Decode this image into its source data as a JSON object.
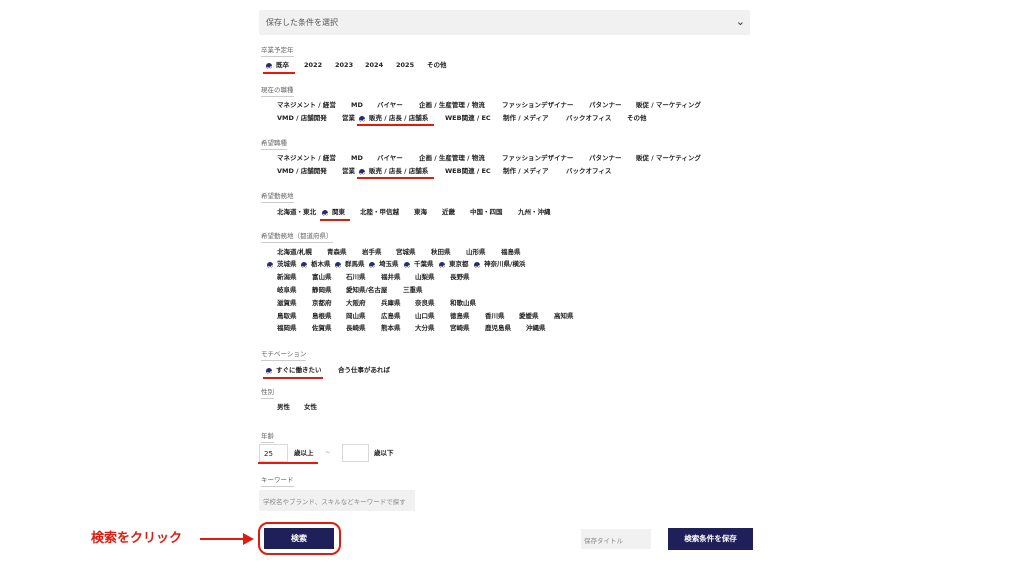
{
  "saved_select": {
    "value": "保存した条件を選択"
  },
  "graduation": {
    "label": "卒業予定年",
    "options": [
      "既卒",
      "2022",
      "2023",
      "2024",
      "2025",
      "その他"
    ]
  },
  "current_job": {
    "label": "現在の職種",
    "row1": [
      "マネジメント / 経営",
      "MD",
      "バイヤー",
      "企画 / 生産管理 / 物流",
      "ファッションデザイナー",
      "パタンナー",
      "販促 / マーケティング"
    ],
    "row2": [
      "VMD / 店舗開発",
      "営業",
      "販売 / 店長 / 店舗系",
      "WEB関連 / EC",
      "制作 / メディア",
      "バックオフィス",
      "その他"
    ]
  },
  "desired_job": {
    "label": "希望職種",
    "row1": [
      "マネジメント / 経営",
      "MD",
      "バイヤー",
      "企画 / 生産管理 / 物流",
      "ファッションデザイナー",
      "パタンナー",
      "販促 / マーケティング"
    ],
    "row2": [
      "VMD / 店舗開発",
      "営業",
      "販売 / 店長 / 店舗系",
      "WEB関連 / EC",
      "制作 / メディア",
      "バックオフィス"
    ]
  },
  "desired_area": {
    "label": "希望勤務地",
    "options": [
      "北海道・東北",
      "関東",
      "北陸・甲信越",
      "東海",
      "近畿",
      "中国・四国",
      "九州・沖縄"
    ]
  },
  "prefecture": {
    "label": "希望勤務地（都道府県）",
    "rows": [
      [
        "北海道/札幌",
        "青森県",
        "岩手県",
        "宮城県",
        "秋田県",
        "山形県",
        "福島県"
      ],
      [
        "茨城県",
        "栃木県",
        "群馬県",
        "埼玉県",
        "千葉県",
        "東京都",
        "神奈川県/横浜"
      ],
      [
        "新潟県",
        "富山県",
        "石川県",
        "福井県",
        "山梨県",
        "長野県"
      ],
      [
        "岐阜県",
        "静岡県",
        "愛知県/名古屋",
        "三重県"
      ],
      [
        "滋賀県",
        "京都府",
        "大阪府",
        "兵庫県",
        "奈良県",
        "和歌山県"
      ],
      [
        "鳥取県",
        "島根県",
        "岡山県",
        "広島県",
        "山口県",
        "徳島県",
        "香川県",
        "愛媛県",
        "高知県"
      ],
      [
        "福岡県",
        "佐賀県",
        "長崎県",
        "熊本県",
        "大分県",
        "宮崎県",
        "鹿児島県",
        "沖縄県"
      ]
    ]
  },
  "motivation": {
    "label": "モチベーション",
    "options": [
      "すぐに働きたい",
      "合う仕事があれば"
    ]
  },
  "gender": {
    "label": "性別",
    "options": [
      "男性",
      "女性"
    ]
  },
  "age": {
    "label": "年齢",
    "min_value": "25",
    "min_suffix": "歳以上",
    "separator": "~",
    "max_value": "",
    "max_suffix": "歳以下"
  },
  "keyword": {
    "label": "キーワード",
    "placeholder": "学校名やブランド、スキルなどキーワードで探す"
  },
  "actions": {
    "search_label": "検索",
    "save_title_placeholder": "保存タイトル",
    "save_label": "検索条件を保存"
  },
  "annotation": {
    "text": "検索をクリック",
    "color": "#e31b0e"
  },
  "colors": {
    "accent": "#1f1f5a",
    "highlight": "#e31b0e"
  }
}
